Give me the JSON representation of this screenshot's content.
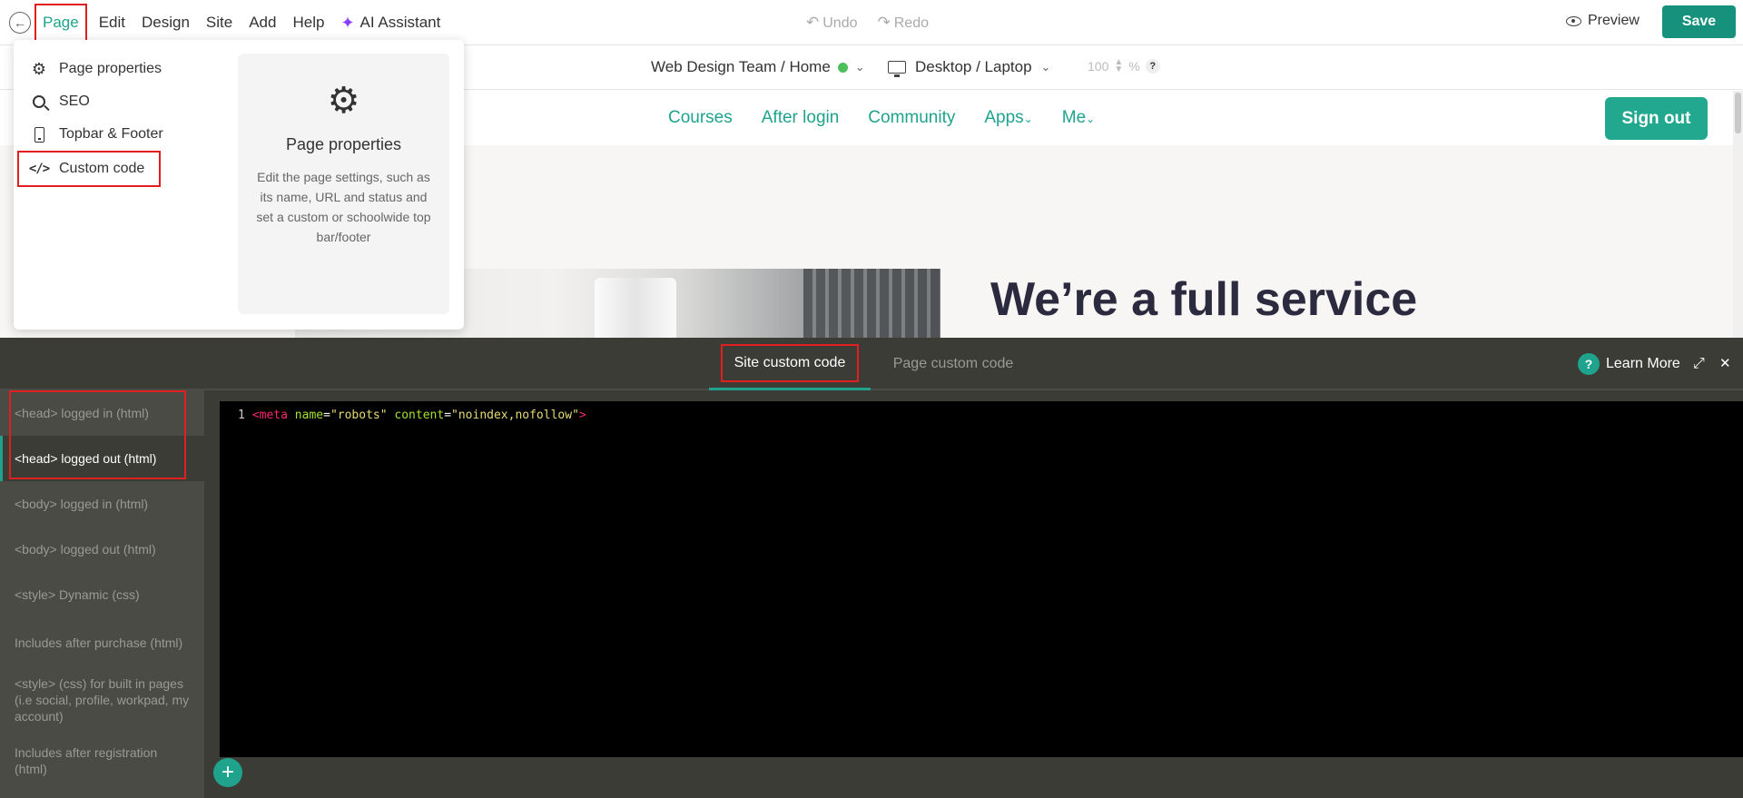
{
  "menubar": {
    "items": [
      {
        "label": "Page"
      },
      {
        "label": "Edit"
      },
      {
        "label": "Design"
      },
      {
        "label": "Site"
      },
      {
        "label": "Add"
      },
      {
        "label": "Help"
      }
    ],
    "ai_label": "AI Assistant",
    "undo_label": "Undo",
    "redo_label": "Redo",
    "preview_label": "Preview",
    "save_label": "Save"
  },
  "subbar": {
    "site_path": "Web Design Team / Home",
    "device": "Desktop / Laptop",
    "zoom_value": "100",
    "zoom_unit": "%",
    "help": "?"
  },
  "page_menu": {
    "items": [
      {
        "label": "Page properties",
        "icon": "gear-icon"
      },
      {
        "label": "SEO",
        "icon": "search-icon"
      },
      {
        "label": "Topbar & Footer",
        "icon": "phone-icon"
      },
      {
        "label": "Custom code",
        "icon": "code-icon"
      }
    ],
    "card_title": "Page properties",
    "card_description": "Edit the page settings, such as its name, URL and status and set a custom or schoolwide top bar/footer"
  },
  "site": {
    "nav": [
      "Courses",
      "After login",
      "Community",
      "Apps",
      "Me"
    ],
    "signout_label": "Sign out",
    "hero_title": "We’re a full service"
  },
  "editor": {
    "tabs": [
      {
        "label": "Site custom code",
        "active": true
      },
      {
        "label": "Page custom code",
        "active": false
      }
    ],
    "learn_more": "Learn More",
    "sidebar": [
      "<head> logged in (html)",
      "<head> logged out (html)",
      "<body> logged in (html)",
      "<body> logged out (html)",
      "<style> Dynamic (css)",
      "Includes after purchase (html)",
      "<style> (css) for built in pages (i.e social, profile, workpad, my account)",
      "Includes after registration (html)"
    ],
    "active_sidebar_index": 1,
    "code": {
      "line_number": "1",
      "tag_open": "<meta",
      "attr1": "name",
      "val1": "\"robots\"",
      "attr2": "content",
      "val2": "\"noindex,nofollow\"",
      "tag_close": ">"
    }
  },
  "colors": {
    "accent": "#1fa38d",
    "highlight": "#e02020",
    "editor_bg": "#3b3c36"
  }
}
